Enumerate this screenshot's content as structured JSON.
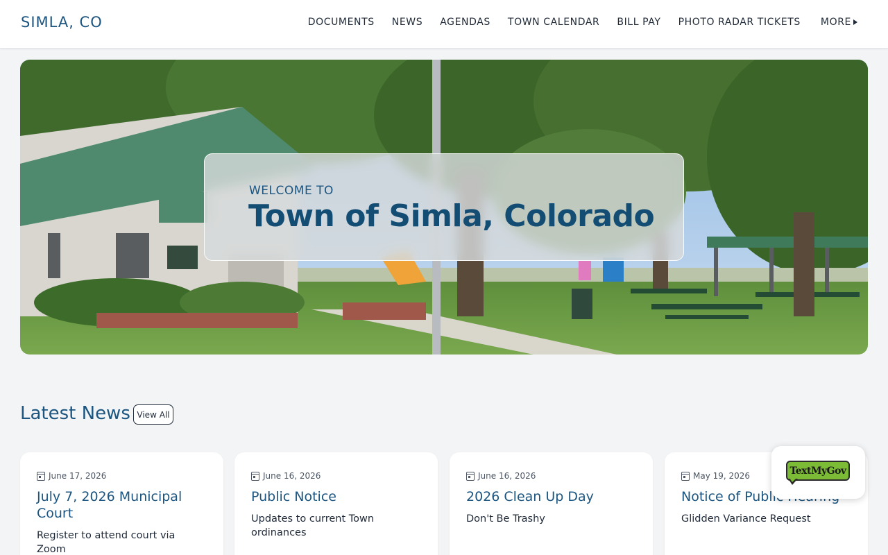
{
  "header": {
    "site_title": "SIMLA, CO",
    "nav": [
      {
        "label": "DOCUMENTS"
      },
      {
        "label": "NEWS"
      },
      {
        "label": "AGENDAS"
      },
      {
        "label": "TOWN CALENDAR"
      },
      {
        "label": "BILL PAY"
      },
      {
        "label": "PHOTO RADAR TICKETS"
      },
      {
        "label": "MORE"
      }
    ]
  },
  "hero": {
    "welcome": "WELCOME TO",
    "title": "Town of Simla, Colorado"
  },
  "news": {
    "heading": "Latest News",
    "view_all_label": "View All",
    "cards": [
      {
        "date": "June 17, 2026",
        "title": "July 7, 2026 Municipal Court",
        "description": "Register to attend court via Zoom"
      },
      {
        "date": "June 16, 2026",
        "title": "Public Notice",
        "description": "Updates to current Town ordinances"
      },
      {
        "date": "June 16, 2026",
        "title": "2026 Clean Up Day",
        "description": "Don't Be Trashy"
      },
      {
        "date": "May 19, 2026",
        "title": "Notice of Public Hearing",
        "description": "Glidden Variance Request"
      }
    ]
  },
  "widget": {
    "label": "TextMyGov"
  },
  "colors": {
    "brand_blue": "#1b5580",
    "widget_green": "#7cbb36"
  }
}
